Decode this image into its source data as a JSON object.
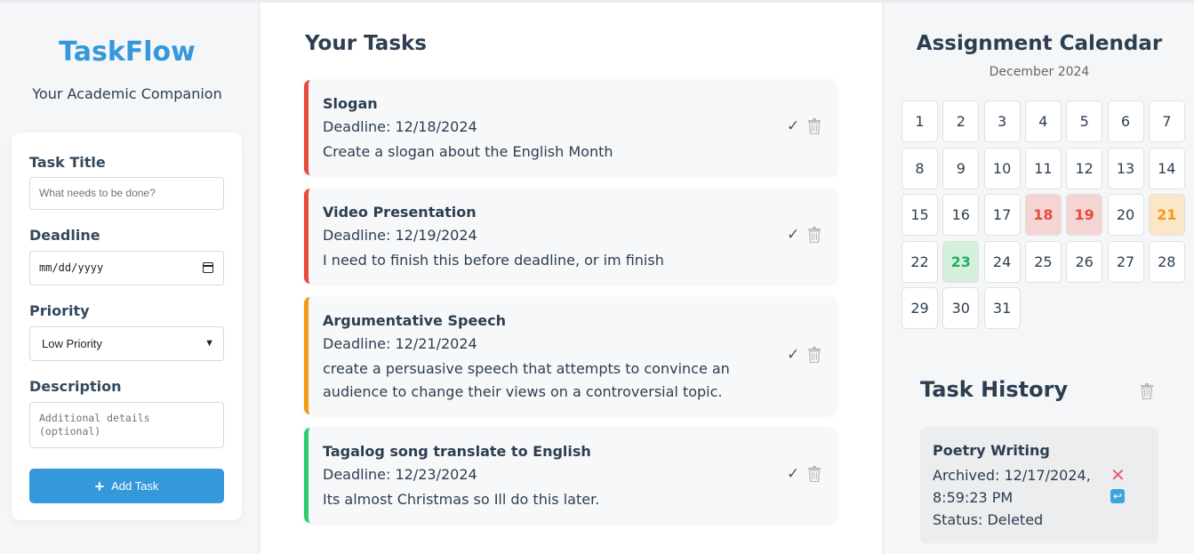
{
  "app": {
    "name": "TaskFlow",
    "tagline": "Your Academic Companion"
  },
  "form": {
    "title_label": "Task Title",
    "title_placeholder": "What needs to be done?",
    "deadline_label": "Deadline",
    "deadline_value": "mm/dd/yyyy",
    "priority_label": "Priority",
    "priority_selected": "Low Priority",
    "description_label": "Description",
    "description_placeholder": "Additional details (optional)",
    "add_button": "Add Task"
  },
  "tasks": {
    "heading": "Your Tasks",
    "items": [
      {
        "title": "Slogan",
        "deadline": "Deadline: 12/18/2024",
        "description": "Create a slogan about the English Month",
        "priority_color": "#e74c3c"
      },
      {
        "title": "Video Presentation",
        "deadline": "Deadline: 12/19/2024",
        "description": "I need to finish this before deadline, or im finish",
        "priority_color": "#e74c3c"
      },
      {
        "title": "Argumentative Speech",
        "deadline": "Deadline: 12/21/2024",
        "description": "create a persuasive speech that attempts to convince an audience to change their views on a controversial topic.",
        "priority_color": "#f39c12"
      },
      {
        "title": "Tagalog song translate to English",
        "deadline": "Deadline: 12/23/2024",
        "description": "Its almost Christmas so Ill do this later.",
        "priority_color": "#2ecc71"
      }
    ],
    "complete_symbol": "✓"
  },
  "calendar": {
    "title": "Assignment Calendar",
    "month": "December 2024",
    "days": [
      "1",
      "2",
      "3",
      "4",
      "5",
      "6",
      "7",
      "8",
      "9",
      "10",
      "11",
      "12",
      "13",
      "14",
      "15",
      "16",
      "17",
      "18",
      "19",
      "20",
      "21",
      "22",
      "23",
      "24",
      "25",
      "26",
      "27",
      "28",
      "29",
      "30",
      "31"
    ],
    "highlights": {
      "18": "red",
      "19": "red",
      "21": "orange",
      "23": "green"
    }
  },
  "history": {
    "title": "Task History",
    "items": [
      {
        "title": "Poetry Writing",
        "archived": "Archived: 12/17/2024, 8:59:23 PM",
        "status": "Status: Deleted"
      }
    ]
  }
}
